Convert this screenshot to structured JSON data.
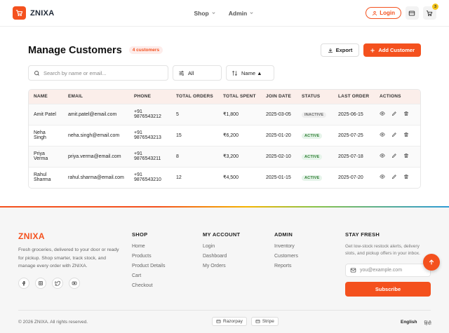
{
  "brand": {
    "name": "ZNIXA",
    "accent": "#f4511e"
  },
  "nav": {
    "shop": "Shop",
    "admin": "Admin",
    "login": "Login",
    "cart_count": "3"
  },
  "page": {
    "title": "Manage Customers",
    "count_badge": "4 customers",
    "export_label": "Export",
    "add_label": "Add Customer"
  },
  "filters": {
    "search_placeholder": "Search by name or email...",
    "status_value": "All",
    "sort_value": "Name ▲"
  },
  "table": {
    "headers": [
      "NAME",
      "EMAIL",
      "PHONE",
      "TOTAL ORDERS",
      "TOTAL SPENT",
      "JOIN DATE",
      "STATUS",
      "LAST ORDER",
      "ACTIONS"
    ],
    "rows": [
      {
        "name": "Amit Patel",
        "email": "amit.patel@email.com",
        "phone_cc": "+91",
        "phone": "9876543212",
        "orders": "5",
        "spent": "₹1,800",
        "joined": "2025-03-05",
        "status": "INACTIVE",
        "last_order": "2025-06-15"
      },
      {
        "name": "Neha Singh",
        "email": "neha.singh@email.com",
        "phone_cc": "+91",
        "phone": "9876543213",
        "orders": "15",
        "spent": "₹6,200",
        "joined": "2025-01-20",
        "status": "ACTIVE",
        "last_order": "2025-07-25"
      },
      {
        "name": "Priya Verma",
        "email": "priya.verma@email.com",
        "phone_cc": "+91",
        "phone": "9876543211",
        "orders": "8",
        "spent": "₹3,200",
        "joined": "2025-02-10",
        "status": "ACTIVE",
        "last_order": "2025-07-18"
      },
      {
        "name": "Rahul Sharma",
        "email": "rahul.sharma@email.com",
        "phone_cc": "+91",
        "phone": "9876543210",
        "orders": "12",
        "spent": "₹4,500",
        "joined": "2025-01-15",
        "status": "ACTIVE",
        "last_order": "2025-07-20"
      }
    ],
    "row_icons": [
      "eye-icon",
      "pencil-icon",
      "trash-icon"
    ]
  },
  "footer": {
    "brand": "ZNIXA",
    "description": "Fresh groceries, delivered to your door or ready for pickup. Shop smarter, track stock, and manage every order with ZNIXA.",
    "socials": [
      "facebook-icon",
      "instagram-icon",
      "twitter-icon",
      "youtube-icon"
    ],
    "shop": {
      "title": "SHOP",
      "links": [
        "Home",
        "Products",
        "Product Details",
        "Cart",
        "Checkout"
      ]
    },
    "account": {
      "title": "MY ACCOUNT",
      "links": [
        "Login",
        "Dashboard",
        "My Orders"
      ]
    },
    "admin": {
      "title": "ADMIN",
      "links": [
        "Inventory",
        "Customers",
        "Reports"
      ]
    },
    "stay": {
      "title": "STAY FRESH",
      "text": "Get low-stock restock alerts, delivery slots, and pickup offers in your inbox.",
      "email_placeholder": "you@example.com",
      "subscribe": "Subscribe"
    },
    "copyright": "© 2026 ZNIXA. All rights reserved.",
    "payments": [
      "Razorpay",
      "Stripe"
    ],
    "lang_current": "English",
    "lang_alt": "हिंदी"
  }
}
